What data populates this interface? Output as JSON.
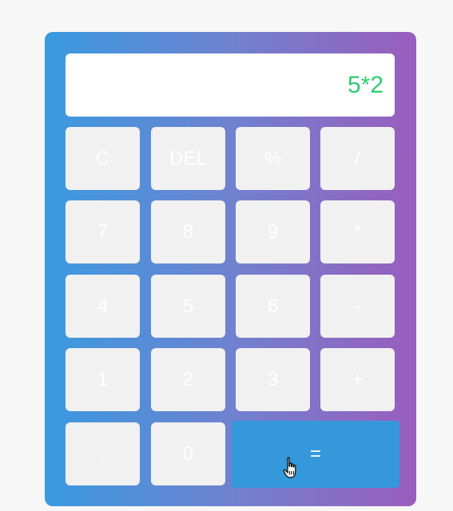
{
  "display": {
    "value": "5*2"
  },
  "keys": {
    "clear": "C",
    "delete": "DEL",
    "percent": "%",
    "divide": "/",
    "seven": "7",
    "eight": "8",
    "nine": "9",
    "multiply": "*",
    "four": "4",
    "five": "5",
    "six": "6",
    "subtract": "-",
    "one": "1",
    "two": "2",
    "three": "3",
    "add": "+",
    "decimal": ".",
    "zero": "0",
    "equals": "="
  },
  "colors": {
    "gradient_start": "#3a9ae0",
    "gradient_end": "#9a5dbd",
    "display_text": "#2ecc71",
    "key_background": "#f1f1f1",
    "equals_background": "#3498db"
  },
  "icons": {
    "cursor": "hand-pointer-icon"
  }
}
